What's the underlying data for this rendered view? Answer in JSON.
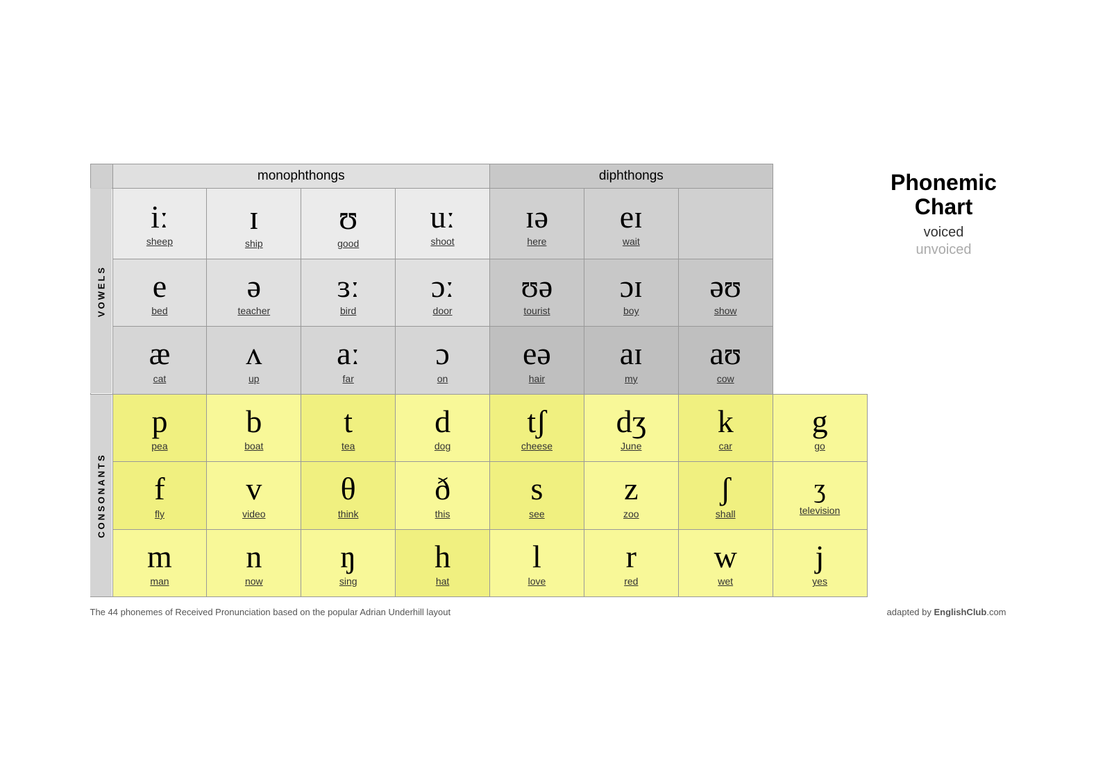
{
  "title": {
    "line1": "Phonemic",
    "line2": "Chart",
    "voiced": "voiced",
    "unvoiced": "unvoiced"
  },
  "headers": {
    "monophthongs": "monophthongs",
    "diphthongs": "diphthongs"
  },
  "sections": {
    "vowels": "VOWELS",
    "consonants": "CONSONANTS"
  },
  "vowel_rows": [
    {
      "cells": [
        {
          "ipa": "iː",
          "word": "sheep"
        },
        {
          "ipa": "ɪ",
          "word": "ship"
        },
        {
          "ipa": "ʊ",
          "word": "good"
        },
        {
          "ipa": "uː",
          "word": "shoot"
        },
        {
          "ipa": "ɪə",
          "word": "here"
        },
        {
          "ipa": "eɪ",
          "word": "wait"
        }
      ]
    },
    {
      "cells": [
        {
          "ipa": "e",
          "word": "bed"
        },
        {
          "ipa": "ə",
          "word": "teacher"
        },
        {
          "ipa": "ɜː",
          "word": "bird"
        },
        {
          "ipa": "ɔː",
          "word": "door"
        },
        {
          "ipa": "ʊə",
          "word": "tourist"
        },
        {
          "ipa": "ɔɪ",
          "word": "boy"
        },
        {
          "ipa": "əʊ",
          "word": "show"
        }
      ]
    },
    {
      "cells": [
        {
          "ipa": "æ",
          "word": "cat"
        },
        {
          "ipa": "ʌ",
          "word": "up"
        },
        {
          "ipa": "aː",
          "word": "far"
        },
        {
          "ipa": "ɒ",
          "word": "on"
        },
        {
          "ipa": "eə",
          "word": "hair"
        },
        {
          "ipa": "aɪ",
          "word": "my"
        },
        {
          "ipa": "aʊ",
          "word": "cow"
        }
      ]
    }
  ],
  "consonant_rows": [
    {
      "cells": [
        {
          "ipa": "p",
          "word": "pea"
        },
        {
          "ipa": "b",
          "word": "boat"
        },
        {
          "ipa": "t",
          "word": "tea"
        },
        {
          "ipa": "d",
          "word": "dog"
        },
        {
          "ipa": "tʃ",
          "word": "cheese"
        },
        {
          "ipa": "dʒ",
          "word": "June"
        },
        {
          "ipa": "k",
          "word": "car"
        },
        {
          "ipa": "g",
          "word": "go"
        }
      ]
    },
    {
      "cells": [
        {
          "ipa": "f",
          "word": "fly"
        },
        {
          "ipa": "v",
          "word": "video"
        },
        {
          "ipa": "θ",
          "word": "think"
        },
        {
          "ipa": "ð",
          "word": "this"
        },
        {
          "ipa": "s",
          "word": "see"
        },
        {
          "ipa": "z",
          "word": "zoo"
        },
        {
          "ipa": "ʃ",
          "word": "shall"
        },
        {
          "ipa": "ʒ",
          "word": "television"
        }
      ]
    },
    {
      "cells": [
        {
          "ipa": "m",
          "word": "man"
        },
        {
          "ipa": "n",
          "word": "now"
        },
        {
          "ipa": "ŋ",
          "word": "sing"
        },
        {
          "ipa": "h",
          "word": "hat"
        },
        {
          "ipa": "l",
          "word": "love"
        },
        {
          "ipa": "r",
          "word": "red"
        },
        {
          "ipa": "w",
          "word": "wet"
        },
        {
          "ipa": "j",
          "word": "yes"
        }
      ]
    }
  ],
  "footer": {
    "left": "The 44 phonemes of Received Pronunciation based on the popular Adrian Underhill layout",
    "right_prefix": "adapted by ",
    "right_brand": "EnglishClub",
    "right_suffix": ".com"
  }
}
